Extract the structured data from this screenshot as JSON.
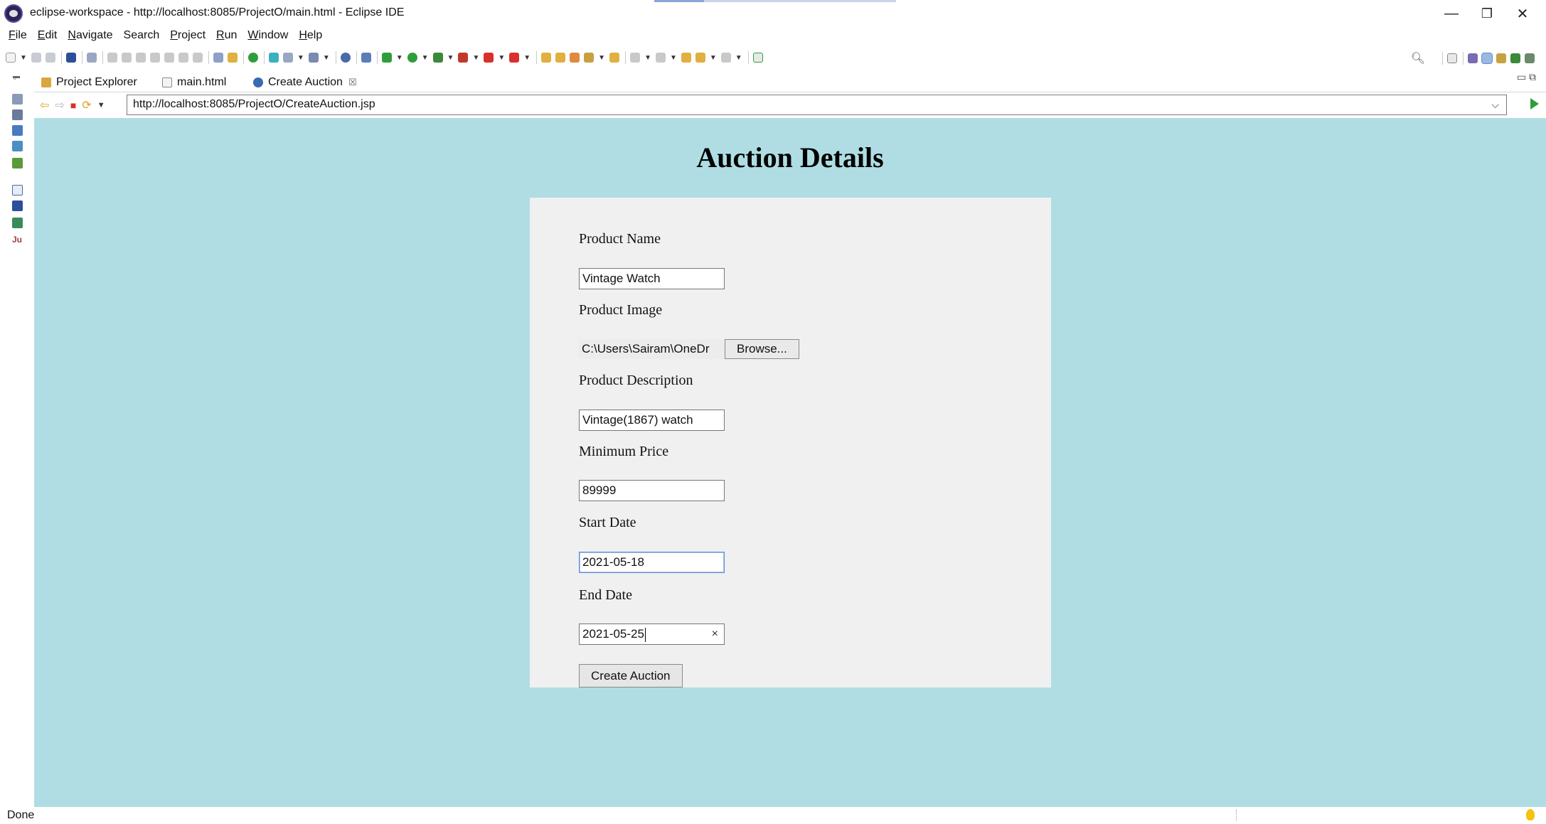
{
  "window": {
    "title": "eclipse-workspace - http://localhost:8085/ProjectO/main.html - Eclipse IDE",
    "controls": {
      "minimize": "—",
      "restore": "❐",
      "close": "✕"
    }
  },
  "menu": [
    {
      "label": "File",
      "u": "F",
      "rest": "ile"
    },
    {
      "label": "Edit",
      "u": "E",
      "rest": "dit"
    },
    {
      "label": "Navigate",
      "u": "N",
      "rest": "avigate"
    },
    {
      "label": "Search",
      "u": "",
      "rest": "Search"
    },
    {
      "label": "Project",
      "u": "P",
      "rest": "roject"
    },
    {
      "label": "Run",
      "u": "R",
      "rest": "un"
    },
    {
      "label": "Window",
      "u": "W",
      "rest": "indow"
    },
    {
      "label": "Help",
      "u": "H",
      "rest": "elp"
    }
  ],
  "tabs": {
    "project_explorer": "Project Explorer",
    "main_html": "main.html",
    "create_auction": "Create Auction",
    "close_glyph": "☒"
  },
  "browser": {
    "url": "http://localhost:8085/ProjectO/CreateAuction.jsp"
  },
  "page": {
    "heading": "Auction Details",
    "fields": {
      "product_name_label": "Product Name",
      "product_name_value": "Vintage Watch",
      "product_image_label": "Product Image",
      "product_image_value": "C:\\Users\\Sairam\\OneDr",
      "browse_label": "Browse...",
      "product_description_label": "Product Description",
      "product_description_value": "Vintage(1867) watch",
      "minimum_price_label": "Minimum Price",
      "minimum_price_value": "89999",
      "start_date_label": "Start Date",
      "start_date_value": "2021-05-18",
      "end_date_label": "End Date",
      "end_date_value": "2021-05-25",
      "clear_glyph": "×"
    },
    "submit_label": "Create Auction"
  },
  "status": {
    "text": "Done"
  },
  "colors": {
    "page_background": "#b0dde4",
    "form_background": "#f0f0f0",
    "focus_border": "#5b8fd6"
  }
}
